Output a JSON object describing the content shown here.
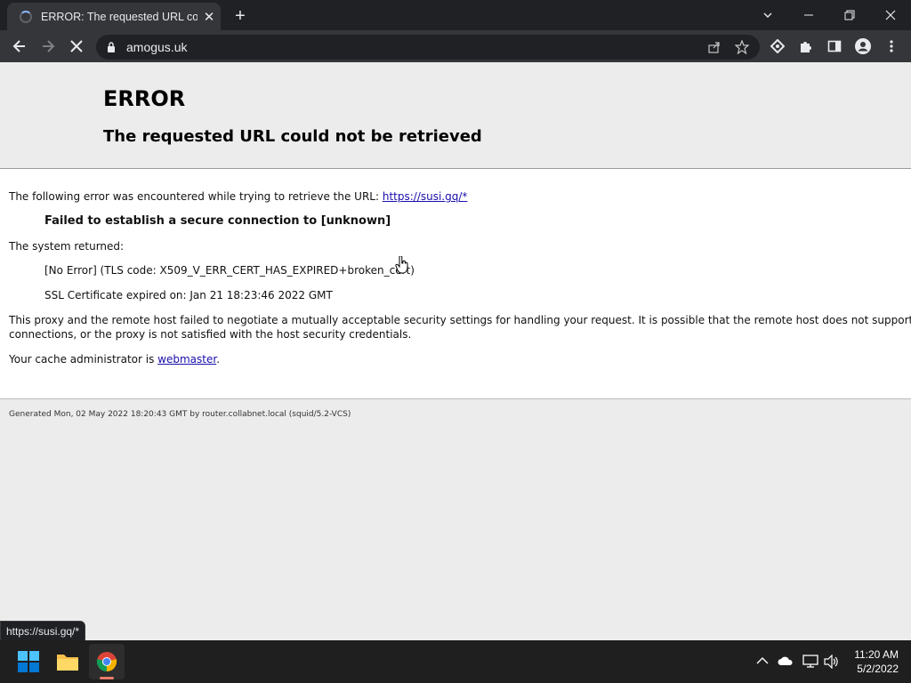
{
  "browser": {
    "tab_title": "ERROR: The requested URL could not be retrieved",
    "tab_close": "✕",
    "new_tab": "+",
    "address": "amogus.uk",
    "status_url": "https://susi.gq/*"
  },
  "page": {
    "title": "ERROR",
    "subtitle": "The requested URL could not be retrieved",
    "intro": "The following error was encountered while trying to retrieve the URL: ",
    "url_link": "https://susi.gq/*",
    "error_message": "Failed to establish a secure connection to [unknown]",
    "system_returned": "The system returned:",
    "tls_code": "[No Error] (TLS code: X509_V_ERR_CERT_HAS_EXPIRED+broken_cert)",
    "ssl_expired": "SSL Certificate expired on: Jan 21 18:23:46 2022 GMT",
    "explanation_line1": "This proxy and the remote host failed to negotiate a mutually acceptable security settings for handling your request. It is possible that the remote host does not support secure",
    "explanation_line2": "connections, or the proxy is not satisfied with the host security credentials.",
    "admin_prefix": "Your cache administrator is ",
    "admin_link": "webmaster",
    "admin_suffix": ".",
    "footer": "Generated Mon, 02 May 2022 18:20:43 GMT by router.collabnet.local (squid/5.2-VCS)"
  },
  "taskbar": {
    "time": "11:20 AM",
    "date": "5/2/2022"
  },
  "colors": {
    "chrome_dark": "#202124",
    "toolbar": "#35363a",
    "link": "#1a0dab",
    "windows_blue": "#0078d4"
  }
}
